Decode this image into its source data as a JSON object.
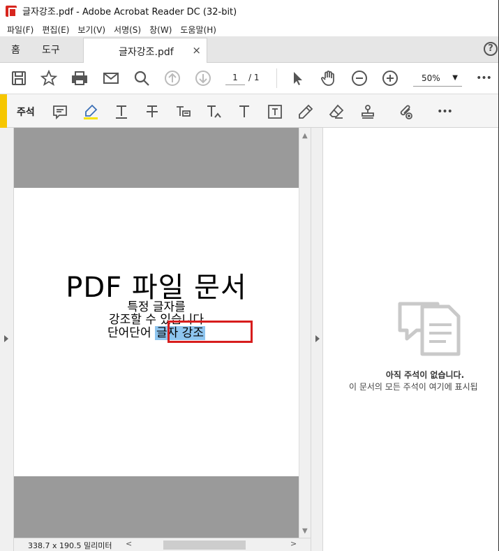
{
  "window": {
    "title": "글자강조.pdf - Adobe Acrobat Reader DC (32-bit)"
  },
  "menu": [
    "파일(F)",
    "편집(E)",
    "보기(V)",
    "서명(S)",
    "창(W)",
    "도움말(H)"
  ],
  "tabs": {
    "home": "홈",
    "tools": "도구",
    "document": "글자강조.pdf",
    "close": "×",
    "help": "?"
  },
  "toolbar": {
    "page_current": "1",
    "page_total": "/ 1",
    "zoom": "50%",
    "zoom_arrow": "▼",
    "more": "•••"
  },
  "comment_toolbar": {
    "label": "주석",
    "more": "•••",
    "accent_color": "#f6c600"
  },
  "document": {
    "title": "PDF 파일 문서",
    "line1": "특정 글자를",
    "line2": "강조할 수 있습니다",
    "line3_prefix": "단어단어 ",
    "line3_highlight": "글자 강조",
    "highlight_color": "#8ec5ef",
    "selection_color": "#d71d1d"
  },
  "status": {
    "size": "338.7 x 190.5 밀리미터",
    "scroll_left": "<",
    "scroll_right": ">"
  },
  "comments_pane": {
    "empty_title": "아직 주석이 없습니다.",
    "empty_subtitle": "이 문서의 모든 주석이 여기에 표시됩"
  }
}
